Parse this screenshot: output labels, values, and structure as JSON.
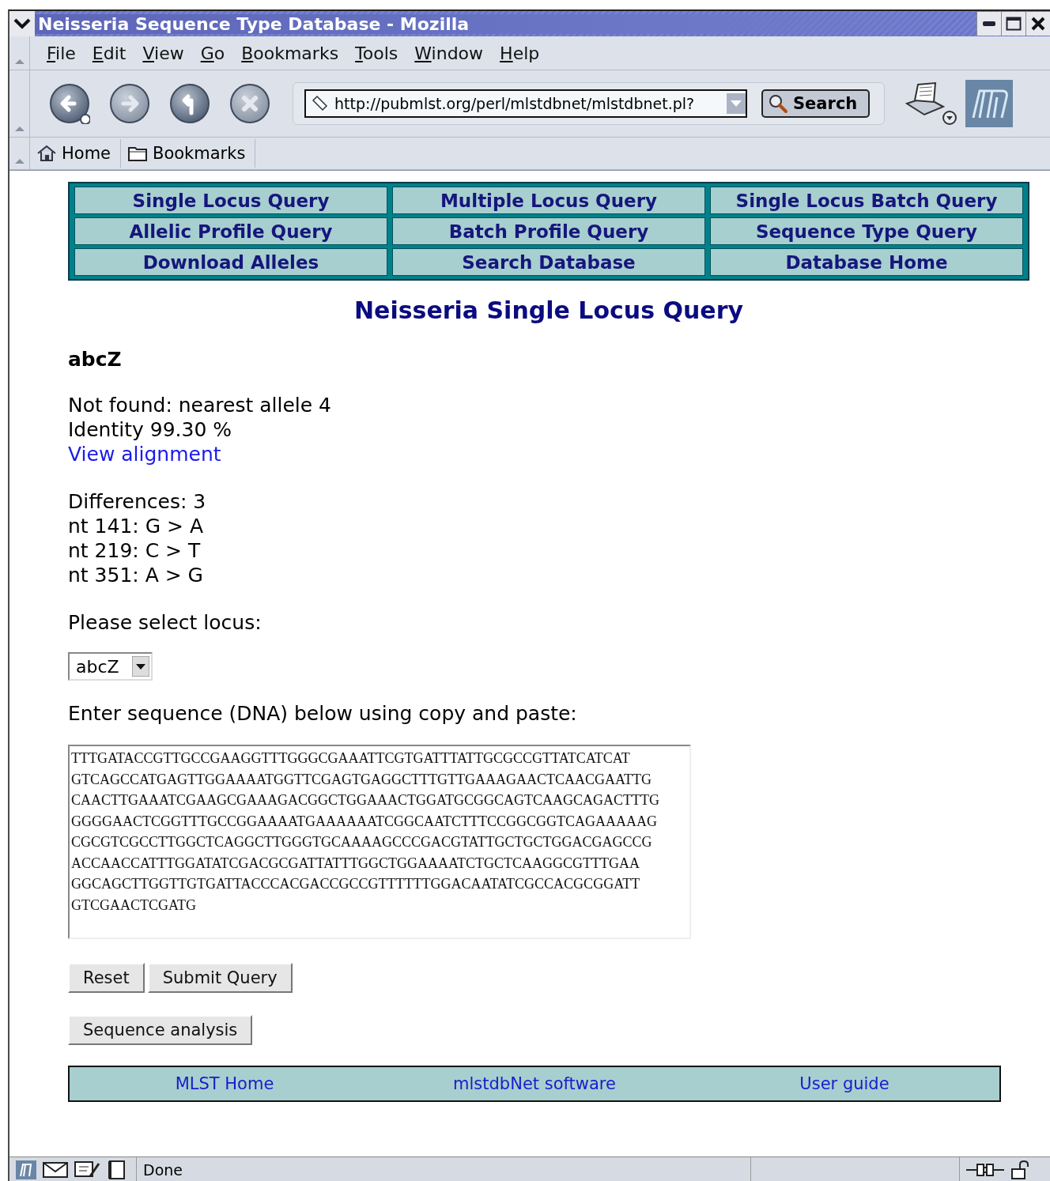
{
  "window": {
    "title": "Neisseria Sequence Type Database - Mozilla"
  },
  "menu": [
    "File",
    "Edit",
    "View",
    "Go",
    "Bookmarks",
    "Tools",
    "Window",
    "Help"
  ],
  "navigation": {
    "url": "http://pubmlst.org/perl/mlstdbnet/mlstdbnet.pl?",
    "search_button": "Search"
  },
  "personal_toolbar": [
    {
      "kind": "home",
      "label": "Home"
    },
    {
      "kind": "folder",
      "label": "Bookmarks"
    }
  ],
  "query_links": [
    [
      "Single Locus Query",
      "Multiple Locus Query",
      "Single Locus Batch Query"
    ],
    [
      "Allelic Profile Query",
      "Batch Profile Query",
      "Sequence Type Query"
    ],
    [
      "Download Alleles",
      "Search Database",
      "Database Home"
    ]
  ],
  "heading": "Neisseria Single Locus Query",
  "locus_title": "abcZ",
  "result": [
    "Not found: nearest allele 4",
    "Identity 99.30 %"
  ],
  "alignment_link": "View alignment",
  "differences": [
    "Differences: 3",
    "nt 141: G > A",
    "nt 219: C > T",
    "nt 351: A > G"
  ],
  "locus_prompt": "Please select locus:",
  "locus_select": "abcZ",
  "sequence_prompt": "Enter sequence (DNA) below using copy and paste:",
  "sequence": "TTTGATACCGTTGCCGAAGGTTTGGGCGAAATTCGTGATTTATTGCGCCGTTATCATCAT\nGTCAGCCATGAGTTGGAAAATGGTTCGAGTGAGGCTTTGTTGAAAGAACTCAACGAATTG\nCAACTTGAAATCGAAGCGAAAGACGGCTGGAAACTGGATGCGGCAGTCAAGCAGACTTTG\nGGGGAACTCGGTTTGCCGGAAAATGAAAAAATCGGCAATCTTTCCGGCGGTCAGAAAAAG\nCGCGTCGCCTTGGCTCAGGCTTGGGTGCAAAAGCCCGACGTATTGCTGCTGGACGAGCCG\nACCAACCATTTGGATATCGACGCGATTATTTGGCTGGAAAATCTGCTCAAGGCGTTTGAA\nGGCAGCTTGGTTGTGATTACCCACGACCGCCGTTTTTTGGACAATATCGCCACGCGGATT\nGTCGAACTCGATG",
  "form_buttons": [
    "Reset",
    "Submit Query"
  ],
  "analysis_button": "Sequence analysis",
  "footer_links": [
    "MLST Home",
    "mlstdbNet software",
    "User guide"
  ],
  "status_bar": {
    "text": "Done"
  }
}
